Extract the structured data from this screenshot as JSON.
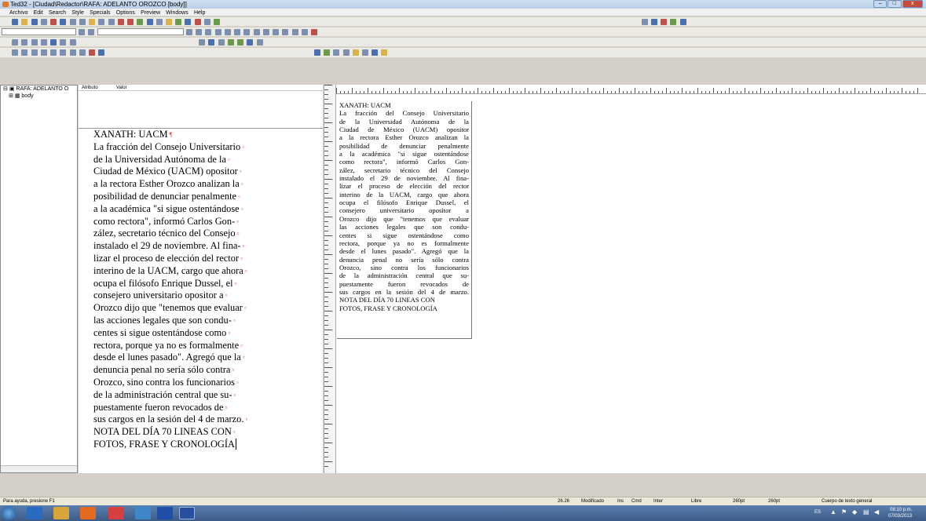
{
  "window": {
    "title": "Ted32 - [Ciudad\\Redactor\\RAFA: ADELANTO OROZCO [body]]",
    "controls": [
      "–",
      "□",
      "x"
    ]
  },
  "menu": [
    "Archivo",
    "Edit",
    "Search",
    "Style",
    "Specials",
    "Options",
    "Preview",
    "Windows",
    "Help"
  ],
  "tree": {
    "root": "RAFA: ADELANTO O",
    "child": "body"
  },
  "attributes": {
    "col1": "Atributo",
    "col2": "Valor"
  },
  "document": {
    "lines": [
      "XANATH: UACM",
      "La fracción del Consejo Universitario",
      "de la Universidad Autónoma de la",
      "Ciudad de México (UACM) opositor",
      "a la rectora Esther Orozco analizan la",
      "posibilidad de denunciar penalmente",
      "a la académica \"si sigue ostentándose",
      "como rectora\", informó Carlos Gon-",
      "zález, secretario técnico del Consejo",
      "instalado el 29 de noviembre. Al fina-",
      "lizar el proceso de elección del rector",
      "interino de la UACM, cargo que ahora",
      "ocupa el filósofo Enrique Dussel, el",
      "consejero universitario opositor a",
      "Orozco dijo que \"tenemos que evaluar",
      "las acciones legales que son condu-",
      "centes si sigue ostentándose como",
      "rectora, porque ya no es formalmente",
      "desde el lunes pasado\". Agregó que la",
      "denuncia penal no sería sólo contra",
      "Orozco, sino contra los funcionarios",
      "de la administración central que su-",
      "puestamente fueron revocados de",
      "sus cargos en la sesión del 4 de marzo.",
      "NOTA DEL DÍA 70 LINEAS CON",
      "FOTOS, FRASE Y CRONOLOGÍA"
    ]
  },
  "preview": {
    "lines": [
      "XANATH: UACM",
      "La fracción del Consejo Universitario",
      "de la Universidad Autónoma de la",
      "Ciudad de México (UACM) opositor",
      "a la rectora Esther Orozco analizan la",
      "posibilidad de denunciar penalmente",
      "a la académica \"si sigue ostentándose",
      "como rectora\", informó Carlos Gon-",
      "zález, secretario técnico del Consejo",
      "instalado el 29 de noviembre. Al fina-",
      "lizar el proceso de elección del rector",
      "interino de la UACM, cargo que ahora",
      "ocupa el filósofo Enrique Dussel, el",
      "consejero universitario opositor a",
      "Orozco dijo que \"tenemos que evaluar",
      "las acciones legales que son condu-",
      "centes si sigue ostentándose como",
      "rectora, porque ya no es formalmente",
      "desde el lunes pasado\". Agregó que la",
      "denuncia penal no sería sólo contra",
      "Orozco, sino contra los funcionarios",
      "de la administración central que su-",
      "puestamente fueron revocados de",
      "sus cargos en la sesión del 4 de marzo.",
      "NOTA DEL DÍA 70 LINEAS CON",
      "FOTOS, FRASE Y CRONOLOGÍA"
    ]
  },
  "status": {
    "help": "Para ayuda, presione F1",
    "pos": "26.26",
    "state": "Modificado",
    "ins": "Ins",
    "cmd": "Cmd",
    "inter": "Inter",
    "libre": "Libre",
    "size1": "260pt",
    "size2": "260pt",
    "style": "Cuerpo de texto general"
  },
  "taskbar": {
    "lang": "ES",
    "time": "08:10 p.m.",
    "date": "07/03/2013"
  },
  "colors": {
    "paragraph_mark": "#e03c3c",
    "title_bar": "#b9cfe7",
    "taskbar": "#3c5a86"
  }
}
